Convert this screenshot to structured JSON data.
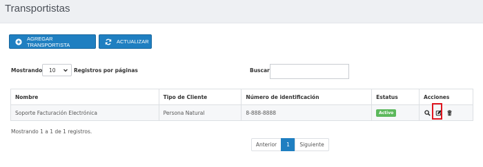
{
  "page": {
    "title": "Transportistas"
  },
  "toolbar": {
    "add_label": "AGREGAR TRANSPORTISTA",
    "refresh_label": "ACTUALIZAR"
  },
  "filters": {
    "show_label": "Mostrando",
    "page_size": "10",
    "show_suffix": "Registros por páginas",
    "search_label": "Buscar:",
    "search_value": ""
  },
  "table": {
    "headers": [
      "Nombre",
      "Tipo de Cliente",
      "Número de identificación",
      "Estatus",
      "Acciones"
    ],
    "rows": [
      {
        "nombre": "Soporte Facturación Electrónica",
        "tipo": "Persona Natural",
        "identificacion": "8-888-8888",
        "estatus": "Activo"
      }
    ]
  },
  "footer": {
    "info": "Mostrando 1 a 1 de 1 registros.",
    "prev": "Anterior",
    "page": "1",
    "next": "Siguiente"
  },
  "colors": {
    "primary": "#1f7fc1",
    "success": "#5cb85c",
    "highlight": "#e0151f"
  }
}
